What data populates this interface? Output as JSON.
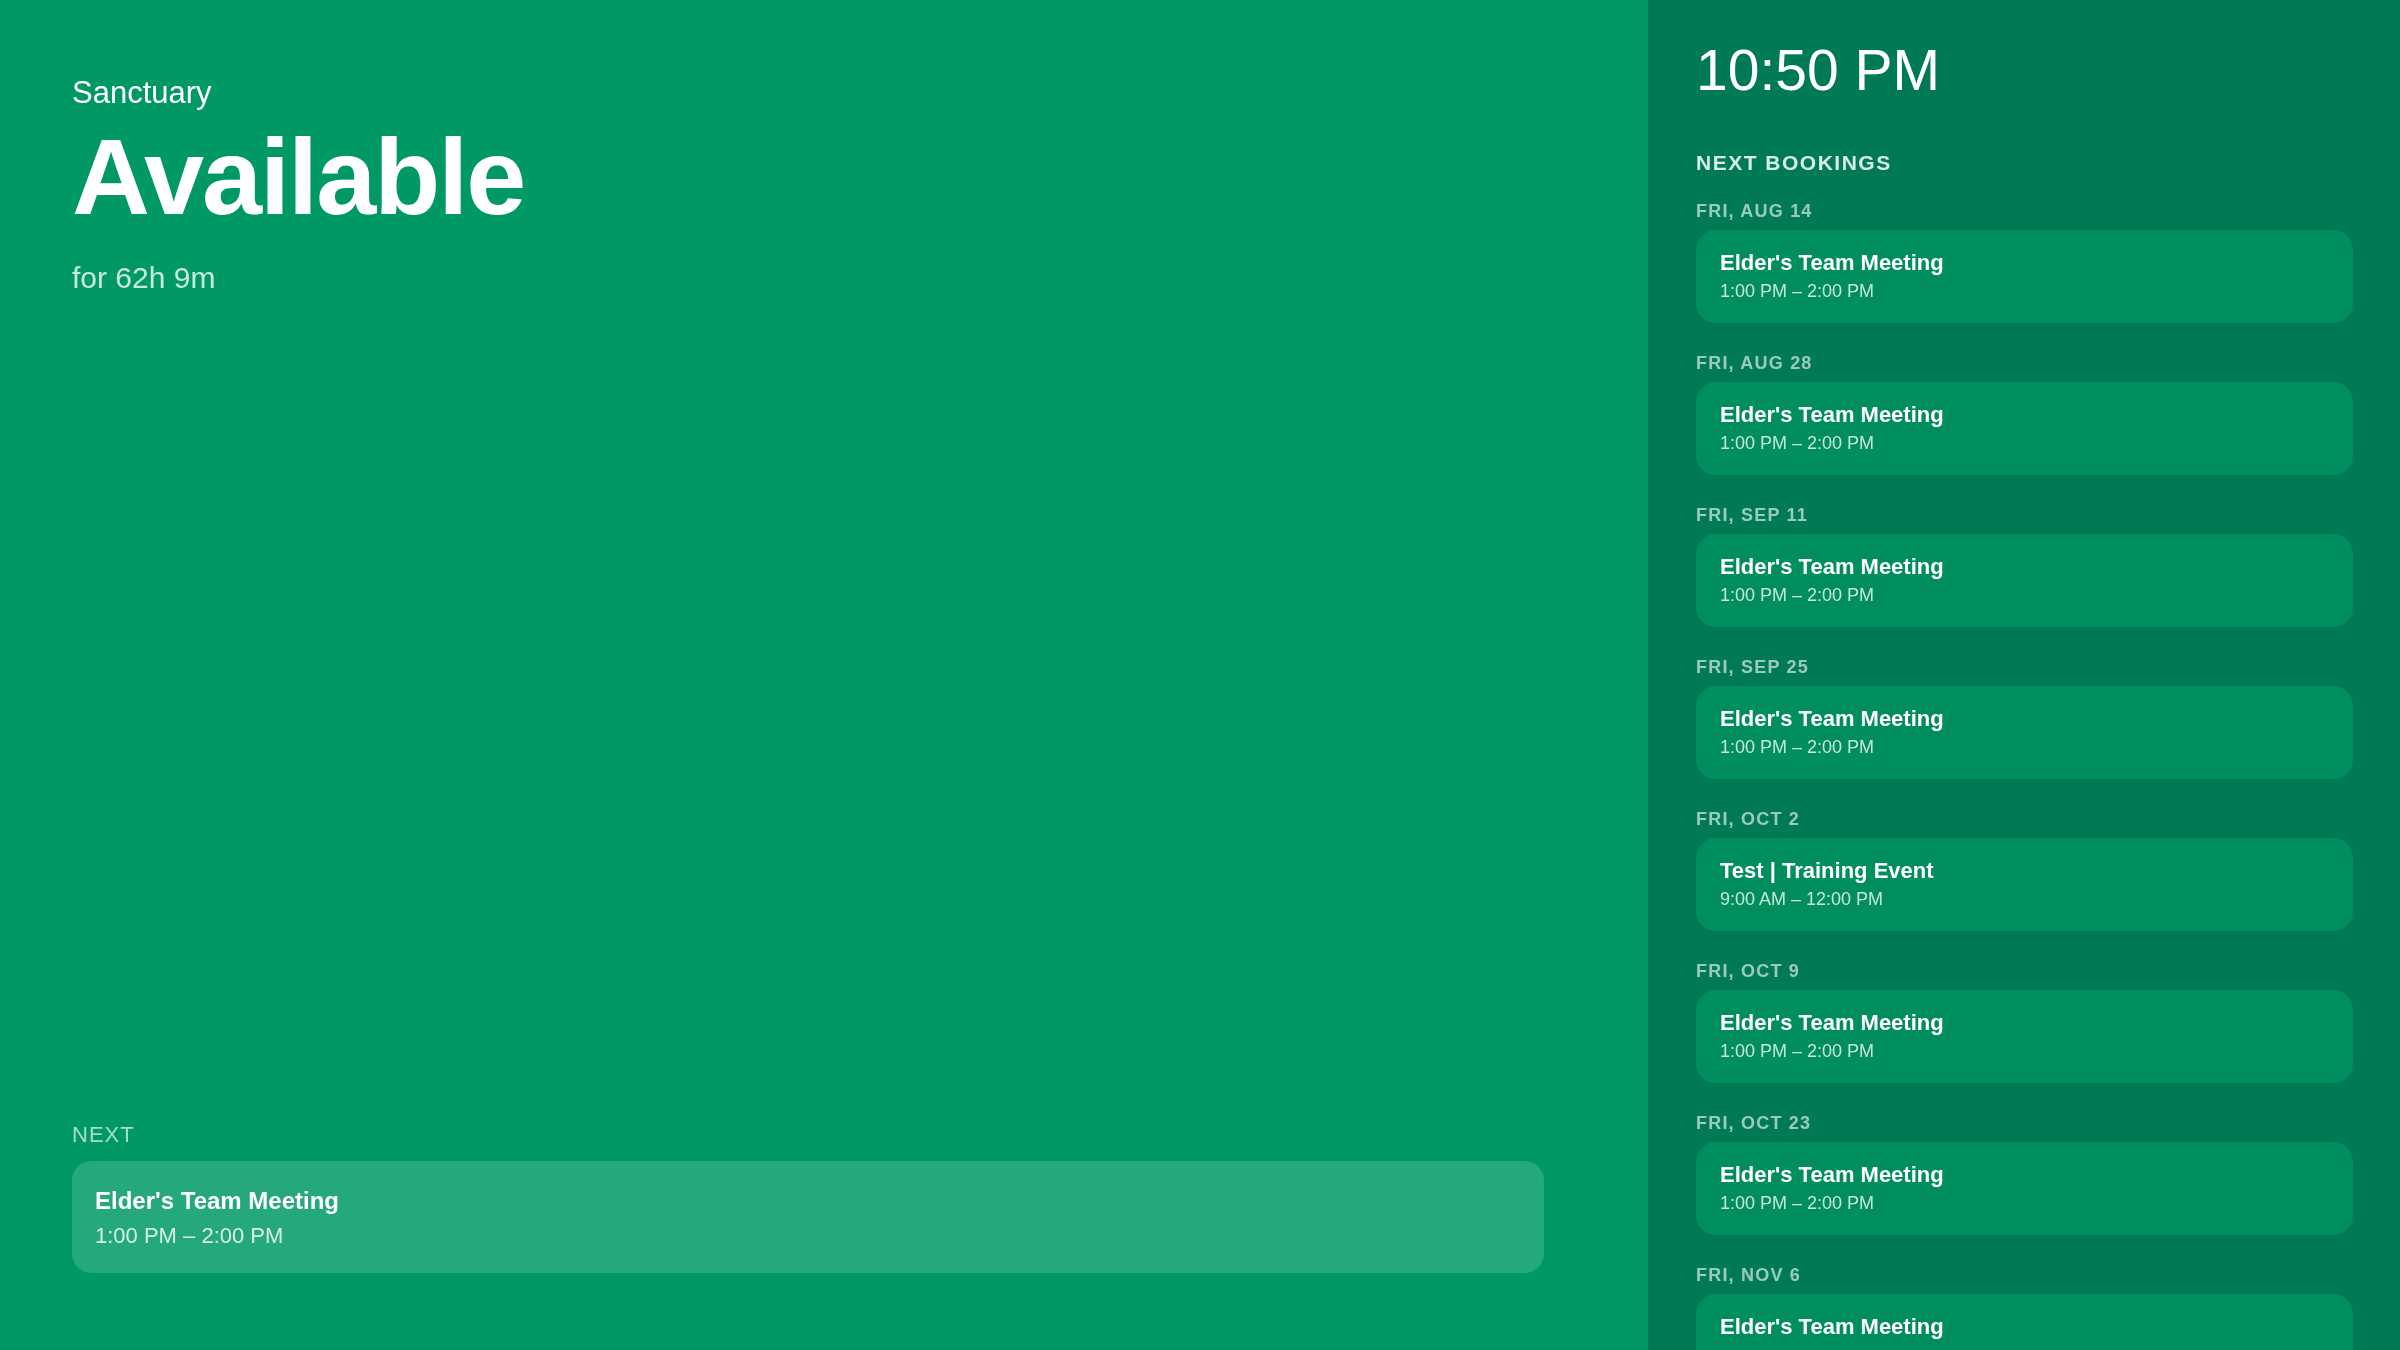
{
  "room": {
    "name": "Sanctuary",
    "status": "Available",
    "duration": "for 62h 9m"
  },
  "next": {
    "label": "NEXT",
    "title": "Elder's Team Meeting",
    "time": "1:00 PM – 2:00 PM"
  },
  "sidebar": {
    "clock": "10:50 PM",
    "heading": "NEXT BOOKINGS",
    "bookings": [
      {
        "date": "FRI, AUG 14",
        "title": "Elder's Team Meeting",
        "time": "1:00 PM – 2:00 PM"
      },
      {
        "date": "FRI, AUG 28",
        "title": "Elder's Team Meeting",
        "time": "1:00 PM – 2:00 PM"
      },
      {
        "date": "FRI, SEP 11",
        "title": "Elder's Team Meeting",
        "time": "1:00 PM – 2:00 PM"
      },
      {
        "date": "FRI, SEP 25",
        "title": "Elder's Team Meeting",
        "time": "1:00 PM – 2:00 PM"
      },
      {
        "date": "FRI, OCT 2",
        "title": "Test | Training Event",
        "time": "9:00 AM – 12:00 PM"
      },
      {
        "date": "FRI, OCT 9",
        "title": "Elder's Team Meeting",
        "time": "1:00 PM – 2:00 PM"
      },
      {
        "date": "FRI, OCT 23",
        "title": "Elder's Team Meeting",
        "time": "1:00 PM – 2:00 PM"
      },
      {
        "date": "FRI, NOV 6",
        "title": "Elder's Team Meeting"
      }
    ]
  }
}
